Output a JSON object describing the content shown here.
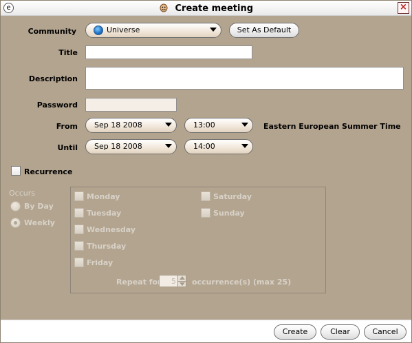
{
  "window": {
    "title": "Create meeting"
  },
  "form": {
    "community_label": "Community",
    "community_value": "Universe",
    "set_default_label": "Set As Default",
    "title_label": "Title",
    "title_value": "",
    "description_label": "Description",
    "description_value": "",
    "password_label": "Password",
    "password_value": "",
    "from_label": "From",
    "from_date": "Sep 18 2008",
    "from_time": "13:00",
    "timezone": "Eastern European Summer Time",
    "until_label": "Until",
    "until_date": "Sep 18 2008",
    "until_time": "14:00",
    "recurrence_label": "Recurrence",
    "recurrence_checked": false
  },
  "recurrence": {
    "occurs_label": "Occurs",
    "by_day_label": "By Day",
    "weekly_label": "Weekly",
    "weekly_selected": true,
    "days_left": [
      "Monday",
      "Tuesday",
      "Wednesday",
      "Thursday",
      "Friday"
    ],
    "days_right": [
      "Saturday",
      "Sunday"
    ],
    "repeat_for_label": "Repeat for",
    "repeat_value": "5",
    "occurrences_label": "occurrence(s) (max 25)"
  },
  "buttons": {
    "create": "Create",
    "clear": "Clear",
    "cancel": "Cancel"
  },
  "icons": {
    "window_menu": "window-menu-icon",
    "app_logo": "app-logo-icon",
    "close": "close-icon",
    "globe": "globe-icon"
  }
}
